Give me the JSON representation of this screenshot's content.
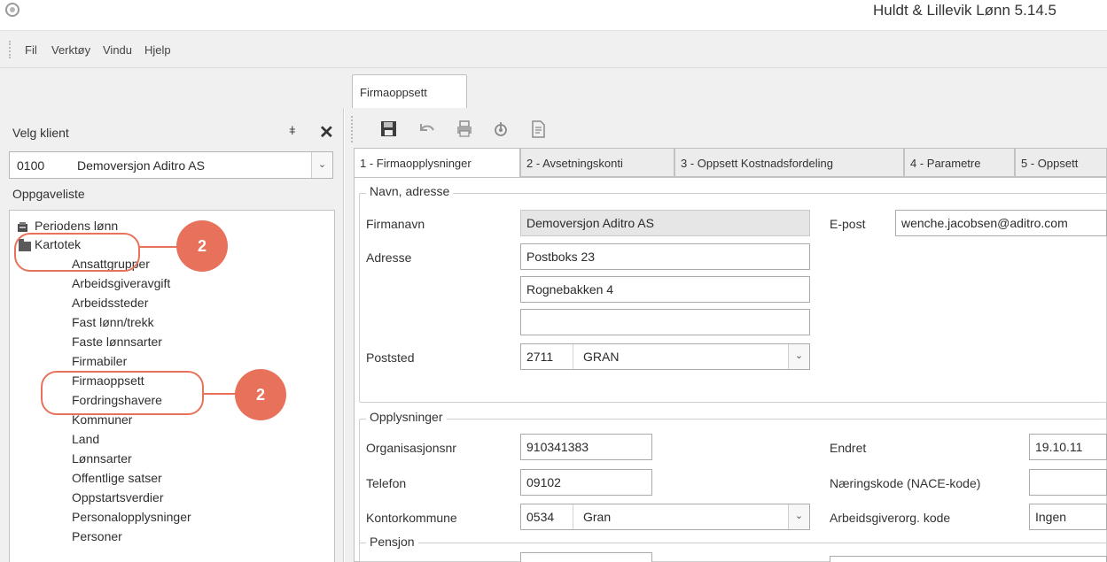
{
  "window": {
    "title": "Huldt & Lillevik Lønn 5.14.5"
  },
  "menu": {
    "items": [
      "Fil",
      "Verktøy",
      "Vindu",
      "Hjelp"
    ]
  },
  "document_tab": {
    "label": "Firmaoppsett"
  },
  "left_panel": {
    "header": "Velg klient",
    "pin_glyph": "ǂ",
    "close_glyph": "✕",
    "client": {
      "code": "0100",
      "name": "Demoversjon Aditro AS"
    },
    "tasklist_label": "Oppgaveliste",
    "tree": {
      "roots": [
        "Periodens lønn",
        "Kartotek"
      ],
      "children": [
        "Ansattgrupper",
        "Arbeidsgiveravgift",
        "Arbeidssteder",
        "Fast lønn/trekk",
        "Faste lønnsarter",
        "Firmabiler",
        "Firmaoppsett",
        "Fordringshavere",
        "Kommuner",
        "Land",
        "Lønnsarter",
        "Offentlige satser",
        "Oppstartsverdier",
        "Personalopplysninger",
        "Personer"
      ]
    }
  },
  "callouts": [
    "2",
    "2"
  ],
  "toolbar": {
    "icons": [
      "save-icon",
      "undo-icon",
      "print-icon",
      "attach-icon",
      "document-icon"
    ]
  },
  "tabs": [
    "1 - Firmaopplysninger",
    "2 - Avsetningskonti",
    "3 - Oppsett Kostnadsfordeling",
    "4 - Parametre",
    "5 - Oppsett"
  ],
  "form": {
    "group_address": {
      "title": "Navn, adresse",
      "firmanavn_label": "Firmanavn",
      "firmanavn": "Demoversjon Aditro AS",
      "adresse_label": "Adresse",
      "adresse1": "Postboks 23",
      "adresse2": "Rognebakken 4",
      "adresse3": "",
      "poststed_label": "Poststed",
      "postnr": "2711",
      "poststed": "GRAN",
      "epost_label": "E-post",
      "epost": "wenche.jacobsen@aditro.com"
    },
    "group_info": {
      "title": "Opplysninger",
      "orgnr_label": "Organisasjonsnr",
      "orgnr": "910341383",
      "telefon_label": "Telefon",
      "telefon": "09102",
      "kontorkommune_label": "Kontorkommune",
      "kommune_nr": "0534",
      "kommune_navn": "Gran",
      "endret_label": "Endret",
      "endret": "19.10.11",
      "nace_label": "Næringskode (NACE-kode)",
      "nace": "",
      "agorg_label": "Arbeidsgiverorg. kode",
      "agorg": "Ingen"
    },
    "group_pension": {
      "title": "Pensjon"
    }
  }
}
